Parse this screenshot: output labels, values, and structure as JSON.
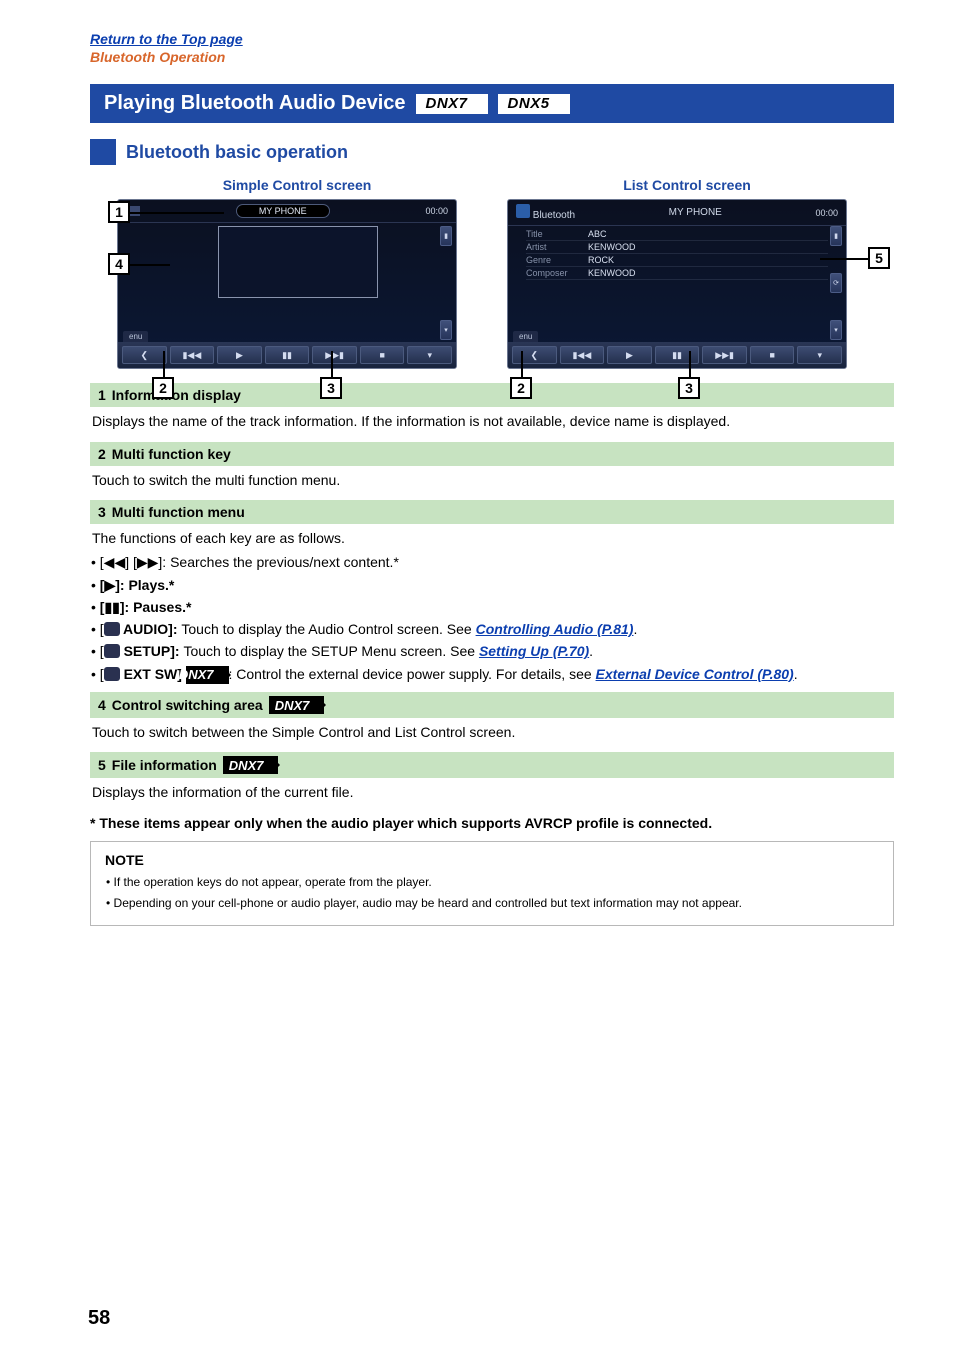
{
  "header": {
    "return_link": "Return to the Top page",
    "breadcrumb": "Bluetooth Operation"
  },
  "section_title": "Playing Bluetooth Audio Device",
  "badges": {
    "dnx7": "DNX7",
    "dnx5": "DNX5"
  },
  "subsection": "Bluetooth basic operation",
  "screens": {
    "simple": {
      "title": "Simple Control screen",
      "device": "MY PHONE",
      "clock": "00:00",
      "menu": "enu",
      "buttons": [
        "❮",
        "▮◀◀",
        "▶",
        "▮▮",
        "▶▶▮",
        "■",
        "▾"
      ]
    },
    "list": {
      "title": "List Control screen",
      "source": "Bluetooth",
      "device": "MY PHONE",
      "clock": "00:00",
      "rows": [
        {
          "k": "Title",
          "v": "ABC"
        },
        {
          "k": "Artist",
          "v": "KENWOOD"
        },
        {
          "k": "Genre",
          "v": "ROCK"
        },
        {
          "k": "Composer",
          "v": "KENWOOD"
        }
      ],
      "menu": "enu",
      "buttons": [
        "❮",
        "▮◀◀",
        "▶",
        "▮▮",
        "▶▶▮",
        "■",
        "▾"
      ]
    }
  },
  "callouts": {
    "1": "1",
    "2": "2",
    "3": "3",
    "4": "4",
    "5": "5"
  },
  "items": {
    "i1": {
      "num": "1",
      "title": "Information display",
      "desc": "Displays the name of the track information. If the information is not available, device name is displayed."
    },
    "i2": {
      "num": "2",
      "title": "Multi function key",
      "desc": "Touch to switch the multi function menu."
    },
    "i3": {
      "num": "3",
      "title": "Multi function menu",
      "desc": "The functions of each key are as follows.",
      "bullets": {
        "b1": "[◀◀] [▶▶]: Searches the previous/next content.*",
        "b2": "[▶]: Plays.*",
        "b3": "[▮▮]: Pauses.*",
        "b4_pre": "[",
        "b4_label": " AUDIO]: ",
        "b4_text": "Touch to display the Audio Control screen. See ",
        "b4_link": "Controlling Audio (P.81)",
        "b4_end": ".",
        "b5_pre": "[",
        "b5_label": " SETUP]: ",
        "b5_text": "Touch to display the SETUP Menu screen. See ",
        "b5_link": "Setting Up (P.70)",
        "b5_end": ".",
        "b6_pre": "[",
        "b6_label": " EXT SW] ",
        "b6_text": ": Control the external device power supply. For details, see ",
        "b6_link": "External Device Control (P.80)",
        "b6_end": "."
      }
    },
    "i4": {
      "num": "4",
      "title": "Control switching area",
      "desc": "Touch to switch between the Simple Control and List Control screen."
    },
    "i5": {
      "num": "5",
      "title": "File information",
      "desc": "Displays the information of the current file."
    }
  },
  "footnote": "* These items appear only when the audio player which supports AVRCP profile is connected.",
  "note": {
    "heading": "NOTE",
    "n1": "If the operation keys do not appear, operate from the player.",
    "n2": "Depending on your cell-phone or audio player, audio may be heard and controlled but text information may not appear."
  },
  "page": "58"
}
